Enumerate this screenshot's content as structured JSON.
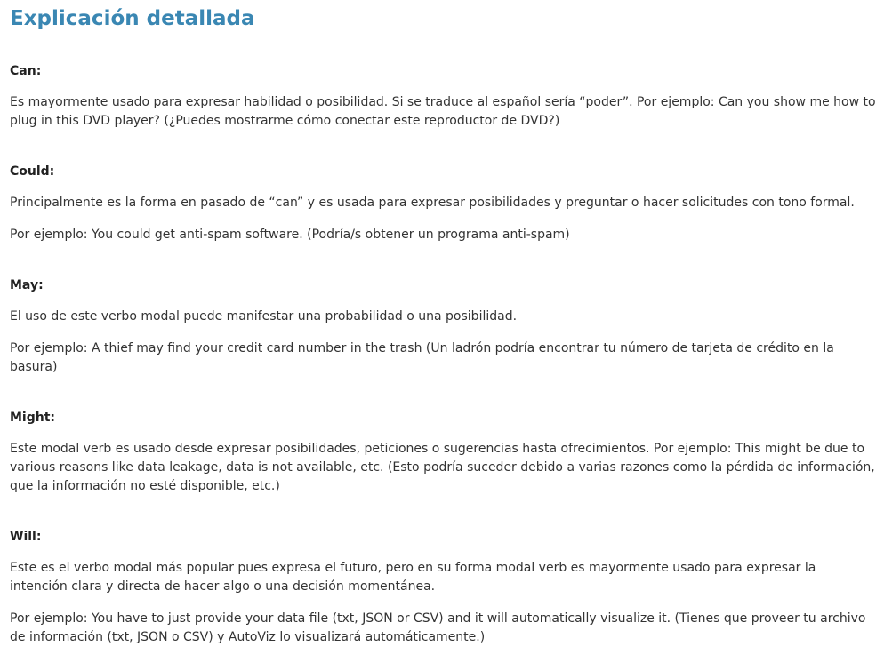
{
  "title": "Explicación detallada",
  "sections": [
    {
      "heading": "Can:",
      "paragraphs": [
        "Es mayormente usado para expresar habilidad o posibilidad. Si se traduce al español sería “poder”. Por ejemplo: Can you show me how to plug in this DVD player? (¿Puedes mostrarme cómo conectar este reproductor de DVD?)"
      ]
    },
    {
      "heading": "Could:",
      "paragraphs": [
        "Principalmente es la forma en pasado de “can” y es usada para expresar posibilidades y preguntar o hacer solicitudes con tono formal.",
        "Por ejemplo: You could get anti-spam software.  (Podría/s obtener un programa anti-spam)"
      ]
    },
    {
      "heading": "May:",
      "paragraphs": [
        "El uso de este verbo modal puede manifestar una probabilidad o una posibilidad.",
        "Por ejemplo: A thief may find your credit card number in the trash (Un ladrón podría encontrar tu número de tarjeta de crédito en la basura)"
      ]
    },
    {
      "heading": "Might:",
      "paragraphs": [
        "Este modal verb es usado desde expresar posibilidades, peticiones o sugerencias hasta ofrecimientos.  Por ejemplo: This might be due to various reasons like data leakage, data is not available, etc. (Esto podría suceder debido a varias razones como la pérdida de información, que la información no esté disponible, etc.)"
      ]
    },
    {
      "heading": "Will:",
      "paragraphs": [
        "Este es el verbo modal más popular pues expresa el futuro, pero en su forma modal verb es mayormente usado para expresar la intención clara y directa de hacer algo o una decisión momentánea.",
        "Por ejemplo: You have to just provide your data file (txt, JSON or CSV) and it will automatically visualize it. (Tienes que proveer tu archivo de información (txt, JSON o CSV) y AutoViz lo visualizará automáticamente.)"
      ]
    }
  ]
}
